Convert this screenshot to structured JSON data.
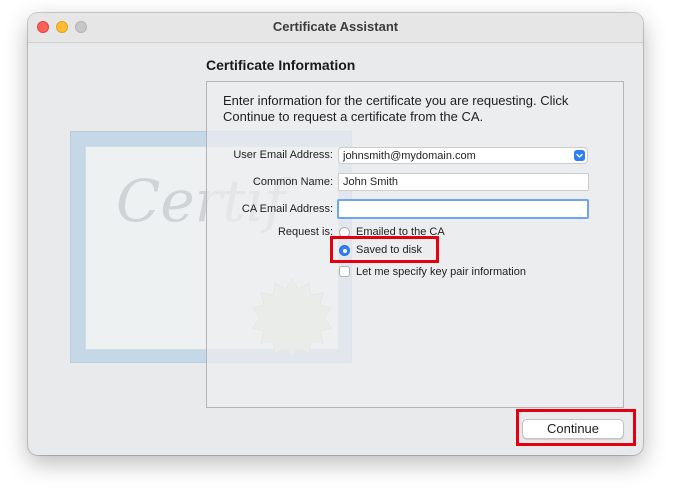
{
  "window": {
    "title": "Certificate Assistant"
  },
  "art": {
    "script_text": "Certif"
  },
  "section": {
    "title": "Certificate Information"
  },
  "intro": "Enter information for the certificate you are requesting. Click Continue to request a certificate from the CA.",
  "form": {
    "user_email_label": "User Email Address:",
    "user_email_value": "johnsmith@mydomain.com",
    "common_name_label": "Common Name:",
    "common_name_value": "John Smith",
    "ca_email_label": "CA Email Address:",
    "ca_email_value": "",
    "request_label": "Request is:",
    "options": [
      {
        "label": "Emailed to the CA",
        "selected": false
      },
      {
        "label": "Saved to disk",
        "selected": true
      }
    ],
    "keypair_label": "Let me specify key pair information",
    "keypair_checked": false
  },
  "buttons": {
    "continue_label": "Continue"
  },
  "colors": {
    "highlight": "#e3000f",
    "accent": "#2f7ff7"
  },
  "icons": [
    "chevron-updown-icon"
  ]
}
